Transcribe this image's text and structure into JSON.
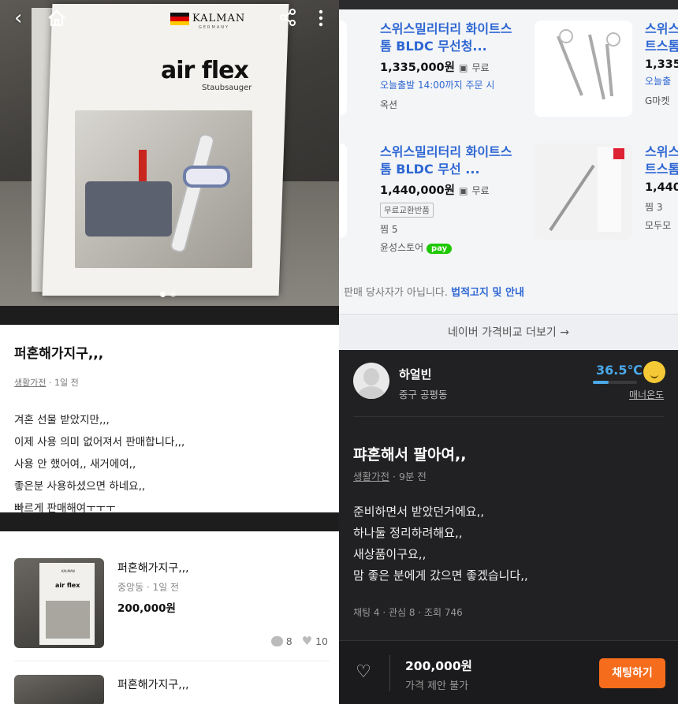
{
  "left": {
    "photo": {
      "brand": "KALMAN",
      "brand_sub": "GERMANY",
      "product_name": "air flex",
      "product_sub": "Staubsauger",
      "back_icon": "chevron-left-icon",
      "home_icon": "home-icon",
      "share_icon": "share-icon",
      "more_icon": "more-vertical-icon"
    },
    "post": {
      "title": "퍼혼해가지구,,,",
      "category": "생활가전",
      "time": "1일 전",
      "body": [
        "겨혼 선물 받았지만,,,",
        "이제 사용 의미 없어져서 판매합니다,,,",
        "사용 안 했어여,, 새거에여,,",
        "좋은분 사용하셨으면 하네요,,",
        "빠르게 판매해여ㅜㅜㅜ"
      ]
    },
    "list": [
      {
        "title": "퍼혼해가지구,,,",
        "meta": "중앙동 · 1일 전",
        "price": "200,000원",
        "chats": "8",
        "likes": "10",
        "thumb_brand": "KALMAN",
        "thumb_name": "air flex"
      },
      {
        "title": "퍼혼해가지구,,,"
      }
    ]
  },
  "right": {
    "ads": [
      {
        "title": "스위스밀리터리 화이트스톰 BLDC 무선청...",
        "price": "1,335,000원",
        "ship": "무료",
        "delivery": "오늘출발 14:00까지 주문 시",
        "store": "옥션"
      },
      {
        "title": "스위스",
        "title2": "트스톰",
        "price": "1,335",
        "delivery": "오늘출",
        "store": "G마켓"
      },
      {
        "title": "스위스밀리터리 화이트스톰 BLDC 무선 ...",
        "price": "1,440,000원",
        "ship": "무료",
        "tag": "무료교환반품",
        "wish": "찜 5",
        "store": "윤성스토어",
        "pay": "pay"
      },
      {
        "title": "스위스",
        "title2": "트스톰",
        "price": "1,440",
        "wish": "찜 3",
        "store": "모두모"
      }
    ],
    "ad_note_prefix": "판매 당사자가 아닙니다.",
    "ad_note_link": "법적고지 및 안내",
    "ad_more": "네이버 가격비교 더보기 →",
    "seller": {
      "name": "하얼빈",
      "location": "중구 공평동",
      "temperature": "36.5℃",
      "temperature_fraction": 0.365,
      "manner_label": "매너온도"
    },
    "post": {
      "title": "퍄혼해서 팔아여,,",
      "category": "생활가전",
      "time": "9분 전",
      "body": [
        "준비하면서 받았던거에요,,",
        "하나둘 정리하려해요,,",
        "새상품이구요,,",
        "맘 좋은 분에게 갔으면 좋겠습니다,,"
      ],
      "stats": "채팅 4 · 관심 8 · 조회 746"
    },
    "bottom": {
      "price": "200,000원",
      "negotiation": "가격 제안 불가",
      "chat_button": "채팅하기",
      "heart_icon": "heart-outline-icon"
    }
  }
}
